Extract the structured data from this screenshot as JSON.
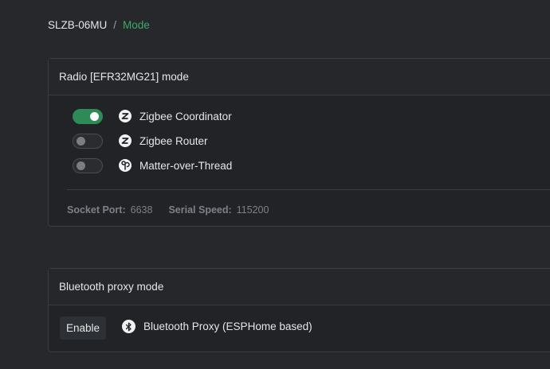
{
  "breadcrumb": {
    "root": "SLZB-06MU",
    "separator": "/",
    "current": "Mode"
  },
  "radio_card": {
    "title": "Radio [EFR32MG21] mode",
    "modes": [
      {
        "label": "Zigbee Coordinator",
        "enabled": true,
        "icon": "zigbee-icon"
      },
      {
        "label": "Zigbee Router",
        "enabled": false,
        "icon": "zigbee-icon"
      },
      {
        "label": "Matter-over-Thread",
        "enabled": false,
        "icon": "thread-icon"
      }
    ],
    "socket_port_label": "Socket Port:",
    "socket_port_value": "6638",
    "serial_speed_label": "Serial Speed:",
    "serial_speed_value": "115200"
  },
  "bluetooth_card": {
    "title": "Bluetooth proxy mode",
    "enable_button": "Enable",
    "proxy_label": "Bluetooth Proxy (ESPHome based)",
    "icon": "bluetooth-icon"
  },
  "colors": {
    "background": "#26282c",
    "card": "#212327",
    "accent": "#2e8b57",
    "accent_text": "#3fa96a"
  }
}
